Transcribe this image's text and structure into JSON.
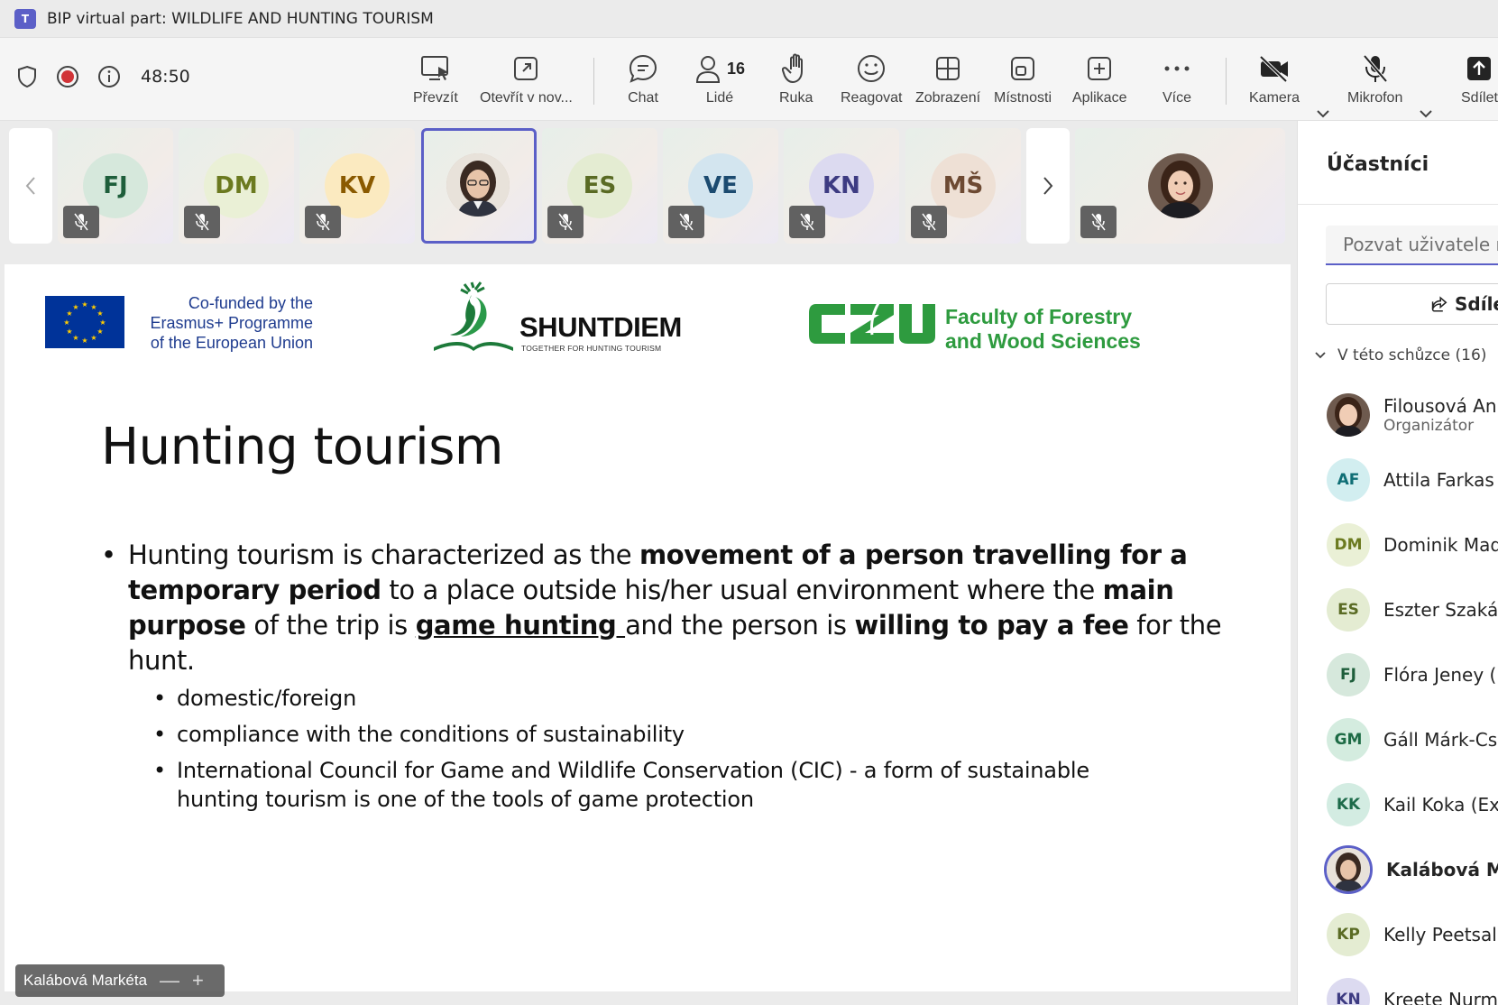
{
  "window": {
    "title": "BIP virtual part: WILDLIFE AND HUNTING TOURISM",
    "app_logo": "T"
  },
  "toolbar": {
    "timer": "48:50",
    "buttons": {
      "share_tray": "Převzít",
      "open_new": "Otevřít v nov...",
      "chat": "Chat",
      "people": "Lidé",
      "people_count": "16",
      "raise_hand": "Ruka",
      "react": "Reagovat",
      "view": "Zobrazení",
      "rooms": "Místnosti",
      "apps": "Aplikace",
      "more": "Více",
      "camera": "Kamera",
      "mic": "Mikrofon",
      "share": "Sdílet"
    }
  },
  "strip": {
    "tiles": [
      {
        "initials": "FJ",
        "color": "#1e5e3b",
        "bg": "#d6e8dc"
      },
      {
        "initials": "DM",
        "color": "#6b7a1f",
        "bg": "#eaf0d6"
      },
      {
        "initials": "KV",
        "color": "#8a5a00",
        "bg": "#fbeac0"
      },
      {
        "initials": "",
        "photo": true
      },
      {
        "initials": "ES",
        "color": "#5a6b24",
        "bg": "#e4ecd2"
      },
      {
        "initials": "VE",
        "color": "#1c4b70",
        "bg": "#d3e5ef"
      },
      {
        "initials": "KN",
        "color": "#3d3b82",
        "bg": "#dcdaf0"
      },
      {
        "initials": "MŠ",
        "color": "#6d4a33",
        "bg": "#eee0d5"
      }
    ]
  },
  "slide": {
    "eu_text_lines": [
      "Co-funded by the",
      "Erasmus+ Programme",
      "of the European Union"
    ],
    "shunt_name": "SHUNTDIEM",
    "shunt_tagline": "TOGETHER FOR HUNTING TOURISM",
    "czu": "CZU",
    "faculty_lines": [
      "Faculty of Forestry",
      "and Wood Sciences"
    ],
    "title": "Hunting tourism",
    "bullet": {
      "p1": "Hunting tourism is characterized as the ",
      "b1": "movement of a person travelling for a temporary period",
      "p2": " to a place outside his/her usual environment where the ",
      "b2": "main purpose",
      "p3": " of the trip is ",
      "u1": "game hunting ",
      "p4": "and the person is ",
      "b3": "willing to pay a fee",
      "p5": " for the hunt."
    },
    "subs": [
      "domestic/foreign",
      "compliance with the conditions of sustainability",
      "International Council for Game and Wildlife Conservation (CIC) - a form of sustainable hunting tourism is one of the tools of game protection"
    ]
  },
  "presenter": {
    "name": "Kalábová Markéta"
  },
  "panel": {
    "title": "Účastníci",
    "invite_placeholder": "Pozvat uživatele ne",
    "share_label": "Sdíle",
    "section": "V této schůzce (16)",
    "participants": [
      {
        "name": "Filousová Ann",
        "role": "Organizátor",
        "initials": "",
        "photo": true
      },
      {
        "name": "Attila Farkas (E",
        "initials": "AF",
        "color": "#0f6e75",
        "bg": "#d2eef0"
      },
      {
        "name": "Dominik Mad",
        "initials": "DM",
        "color": "#6b7a1f",
        "bg": "#eaf0d6"
      },
      {
        "name": "Eszter Szakács",
        "initials": "ES",
        "color": "#5a6b24",
        "bg": "#e4ecd2"
      },
      {
        "name": "Flóra Jeney (E",
        "initials": "FJ",
        "color": "#1e5e3b",
        "bg": "#d6e8dc"
      },
      {
        "name": "Gáll Márk-Csa",
        "initials": "GM",
        "color": "#1d6b45",
        "bg": "#d4ecdf"
      },
      {
        "name": "Kail Koka (Exte",
        "initials": "KK",
        "color": "#1d6b4a",
        "bg": "#d3ece2"
      },
      {
        "name": "Kalábová Ma",
        "initials": "",
        "photo": true,
        "bold": true
      },
      {
        "name": "Kelly Peetsalu",
        "initials": "KP",
        "color": "#5a6b24",
        "bg": "#e4ecd2"
      },
      {
        "name": "Kreete Nurme",
        "initials": "KN",
        "color": "#3d3b82",
        "bg": "#dcdaf0"
      }
    ]
  }
}
